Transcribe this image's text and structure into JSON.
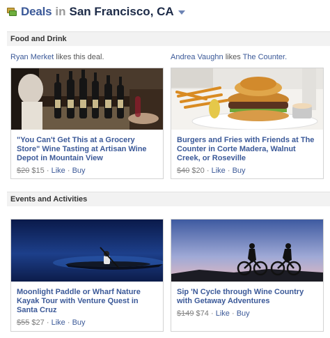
{
  "header": {
    "title": "Deals",
    "in": "in",
    "city": "San Francisco, CA",
    "icon": "deals-tag-icon",
    "dropdown_icon": "chevron-down-icon"
  },
  "sections": [
    {
      "title": "Food and Drink",
      "deals": [
        {
          "liker_name": "Ryan Merket",
          "liker_text": " likes this deal.",
          "liker_link": "",
          "title": "\"You Can't Get This at a Grocery Store\" Wine Tasting at Artisan Wine Depot in Mountain View",
          "old_price": "$20",
          "new_price": "$15",
          "like": "Like",
          "buy": "Buy"
        },
        {
          "liker_name": "Andrea Vaughn",
          "liker_text": " likes ",
          "liker_link": "The Counter.",
          "title": "Burgers and Fries with Friends at The Counter in Corte Madera, Walnut Creek, or Roseville",
          "old_price": "$40",
          "new_price": "$20",
          "like": "Like",
          "buy": "Buy"
        }
      ]
    },
    {
      "title": "Events and Activities",
      "deals": [
        {
          "title": "Moonlight Paddle or Wharf Nature Kayak Tour with Venture Quest in Santa Cruz",
          "old_price": "$55",
          "new_price": "$27",
          "like": "Like",
          "buy": "Buy"
        },
        {
          "title": "Sip 'N Cycle through Wine Country with Getaway Adventures",
          "old_price": "$149",
          "new_price": "$74",
          "like": "Like",
          "buy": "Buy"
        }
      ]
    }
  ],
  "separator": "·",
  "colors": {
    "link": "#3b5998",
    "section_bg": "#f2f2f2",
    "muted": "#777777"
  }
}
